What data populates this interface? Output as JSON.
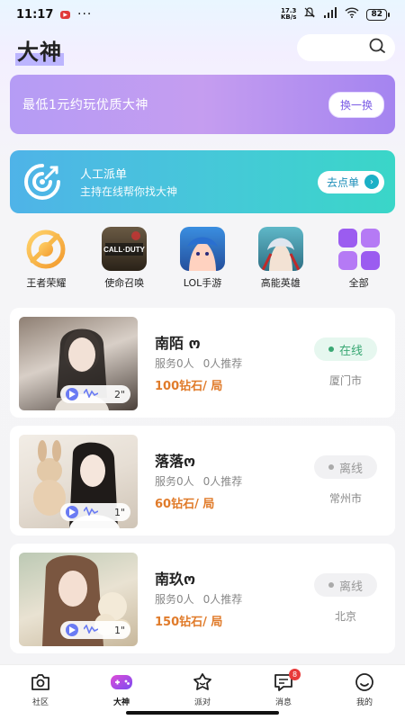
{
  "status_bar": {
    "time": "11:17",
    "net_speed_value": "17.3",
    "net_speed_unit": "KB/s",
    "battery": "82"
  },
  "header": {
    "title": "大神"
  },
  "promo_banner": {
    "text": "最低1元约玩优质大神",
    "button": "换一换"
  },
  "dispatch_banner": {
    "title": "人工派单",
    "subtitle": "主持在线帮你找大神",
    "button": "去点单"
  },
  "categories": [
    {
      "label": "王者荣耀",
      "icon": "honor-of-kings-icon"
    },
    {
      "label": "使命召唤",
      "icon": "call-of-duty-icon"
    },
    {
      "label": "LOL手游",
      "icon": "lol-mobile-icon"
    },
    {
      "label": "高能英雄",
      "icon": "high-energy-heroes-icon"
    },
    {
      "label": "全部",
      "icon": "all-grid-icon"
    }
  ],
  "cards": [
    {
      "name": "南陌 ო",
      "services": "服务0人",
      "recommend": "0人推荐",
      "price": "100钻石/ 局",
      "status": "在线",
      "city": "厦门市",
      "duration": "2\""
    },
    {
      "name": "落落ო",
      "services": "服务0人",
      "recommend": "0人推荐",
      "price": "60钻石/ 局",
      "status": "离线",
      "city": "常州市",
      "duration": "1\""
    },
    {
      "name": "南玖ო",
      "services": "服务0人",
      "recommend": "0人推荐",
      "price": "150钻石/ 局",
      "status": "离线",
      "city": "北京",
      "duration": "1\""
    }
  ],
  "bottom_nav": [
    {
      "label": "社区"
    },
    {
      "label": "大神"
    },
    {
      "label": "派对"
    },
    {
      "label": "消息",
      "badge": "8"
    },
    {
      "label": "我的"
    }
  ],
  "colors": {
    "accent_purple": "#7b5ce6",
    "price_orange": "#e07b2a",
    "online_green": "#3aa874"
  }
}
